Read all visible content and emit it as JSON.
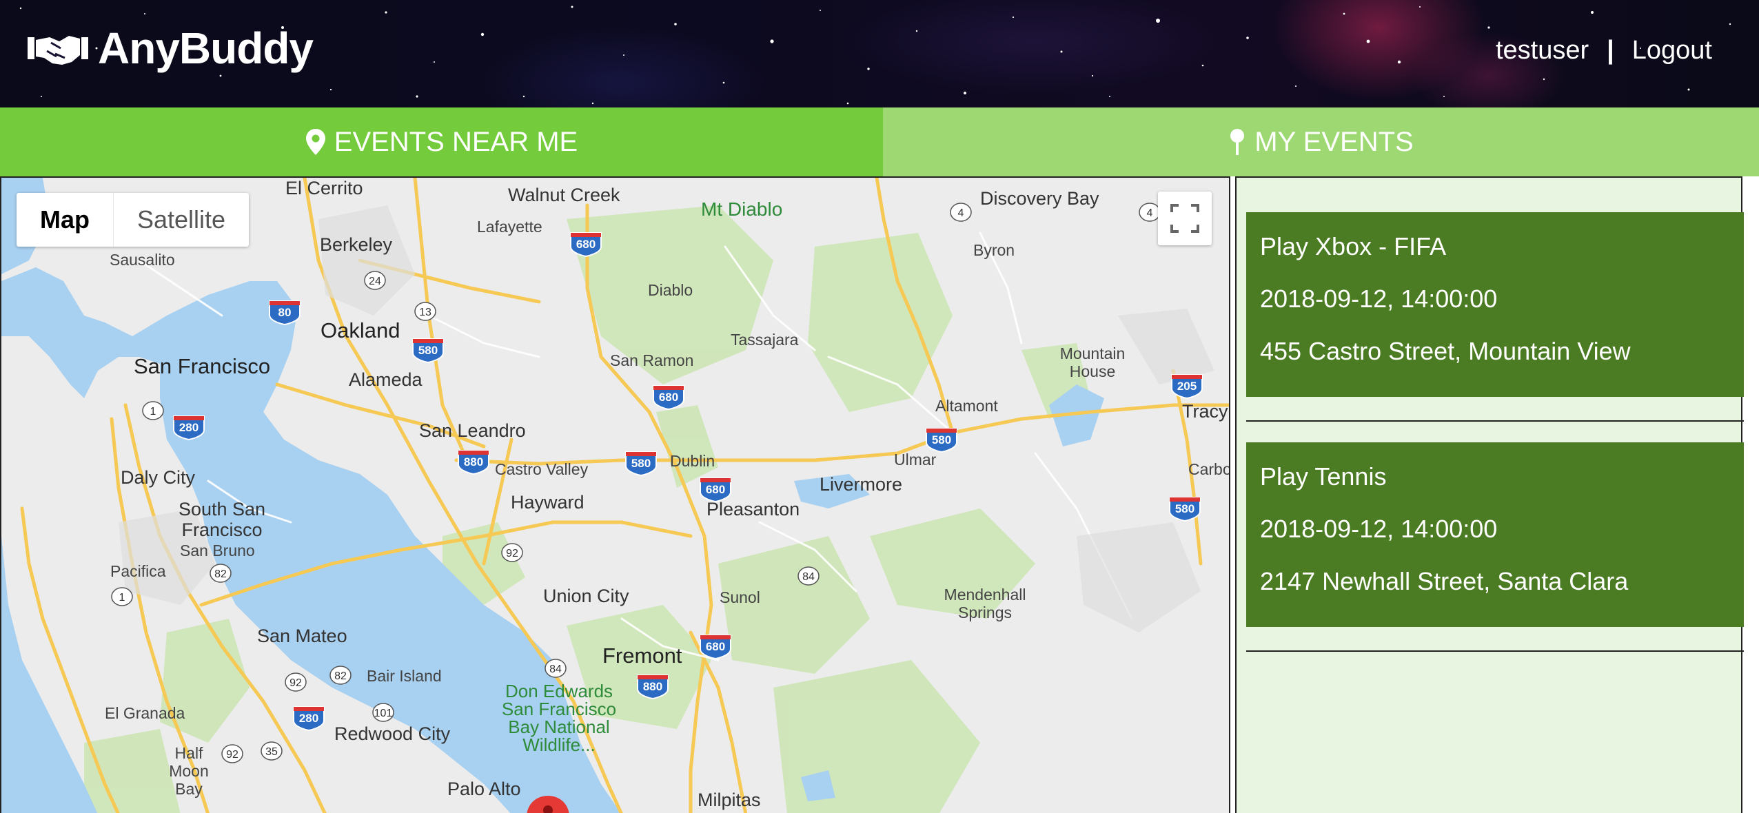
{
  "app": {
    "brand_name": "AnyBuddy",
    "brand_icon": "handshake-icon"
  },
  "user": {
    "username": "testuser",
    "separator": "|",
    "logout_label": "Logout"
  },
  "tabs": [
    {
      "label": "EVENTS NEAR ME",
      "icon": "map-marker-icon",
      "active": true
    },
    {
      "label": "MY EVENTS",
      "icon": "map-pin-icon",
      "active": false
    }
  ],
  "map": {
    "type_options": [
      "Map",
      "Satellite"
    ],
    "selected_type": "Map",
    "fullscreen_icon": "fullscreen-icon",
    "places": [
      "El Cerrito",
      "Walnut Creek",
      "Mt Diablo",
      "Discovery Bay",
      "Berkeley",
      "Lafayette",
      "Byron",
      "Sausalito",
      "Oakland",
      "Diablo",
      "Tassajara",
      "San Francisco",
      "Alameda",
      "San Ramon",
      "Mountain House",
      "Altamont",
      "Tracy",
      "San Leandro",
      "Ulmar",
      "Daly City",
      "Castro Valley",
      "Dublin",
      "Carbo",
      "Livermore",
      "South San Francisco",
      "Hayward",
      "Pleasanton",
      "San Bruno",
      "Pacifica",
      "Union City",
      "Sunol",
      "Mendenhall Springs",
      "San Mateo",
      "Fremont",
      "Bair Island",
      "Don Edwards San Francisco Bay National Wildlife...",
      "El Granada",
      "Redwood City",
      "Half Moon Bay",
      "Palo Alto",
      "Milpitas"
    ],
    "shields": [
      "680",
      "4",
      "4",
      "24",
      "80",
      "13",
      "580",
      "680",
      "205",
      "1",
      "280",
      "580",
      "880",
      "580",
      "680",
      "580",
      "92",
      "84",
      "82",
      "1",
      "680",
      "84",
      "880",
      "92",
      "82",
      "101",
      "280",
      "92",
      "35"
    ]
  },
  "events": [
    {
      "title": "Play Xbox - FIFA",
      "datetime": "2018-09-12, 14:00:00",
      "address": "455 Castro Street, Mountain View"
    },
    {
      "title": "Play Tennis",
      "datetime": "2018-09-12, 14:00:00",
      "address": "2147 Newhall Street, Santa Clara"
    }
  ]
}
